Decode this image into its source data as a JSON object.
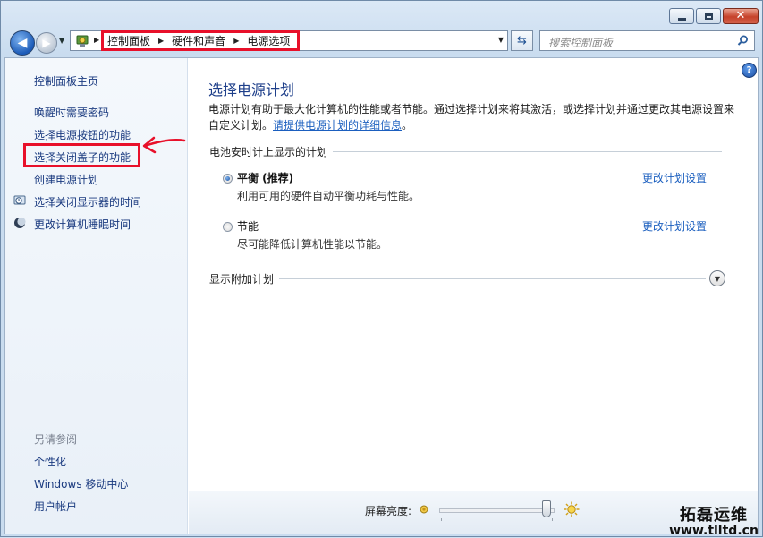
{
  "window": {
    "caption": {
      "minimize": "minimize",
      "maximize": "maximize",
      "close": "close"
    }
  },
  "toolbar": {
    "breadcrumbs": [
      "控制面板",
      "硬件和声音",
      "电源选项"
    ],
    "search_placeholder": "搜索控制面板"
  },
  "sidebar": {
    "home_link": "控制面板主页",
    "items": [
      {
        "label": "唤醒时需要密码",
        "icon": null
      },
      {
        "label": "选择电源按钮的功能",
        "icon": null
      },
      {
        "label": "选择关闭盖子的功能",
        "icon": null,
        "highlighted": true
      },
      {
        "label": "创建电源计划",
        "icon": null
      },
      {
        "label": "选择关闭显示器的时间",
        "icon": "display-clock-icon"
      },
      {
        "label": "更改计算机睡眠时间",
        "icon": "moon-icon"
      }
    ],
    "see_also_title": "另请参阅",
    "see_also": [
      "个性化",
      "Windows 移动中心",
      "用户帐户"
    ]
  },
  "main": {
    "title": "选择电源计划",
    "description": "电源计划有助于最大化计算机的性能或者节能。通过选择计划来将其激活，或选择计划并通过更改其电源设置来自定义计划。",
    "description_link": "请提供电源计划的详细信息",
    "description_end": "。",
    "section_label": "电池安时计上显示的计划",
    "plans": [
      {
        "name": "平衡 (推荐)",
        "desc": "利用可用的硬件自动平衡功耗与性能。",
        "link": "更改计划设置",
        "selected": true
      },
      {
        "name": "节能",
        "desc": "尽可能降低计算机性能以节能。",
        "link": "更改计划设置",
        "selected": false
      }
    ],
    "more_plans_label": "显示附加计划"
  },
  "bottom": {
    "brightness_label": "屏幕亮度:",
    "brightness_level": 0.95
  },
  "watermark": {
    "line1": "拓磊运维",
    "line2": "www.tlltd.cn"
  },
  "colors": {
    "link": "#1b5fbf",
    "annotation_red": "#e8102a",
    "title_blue": "#1e3f8a"
  }
}
